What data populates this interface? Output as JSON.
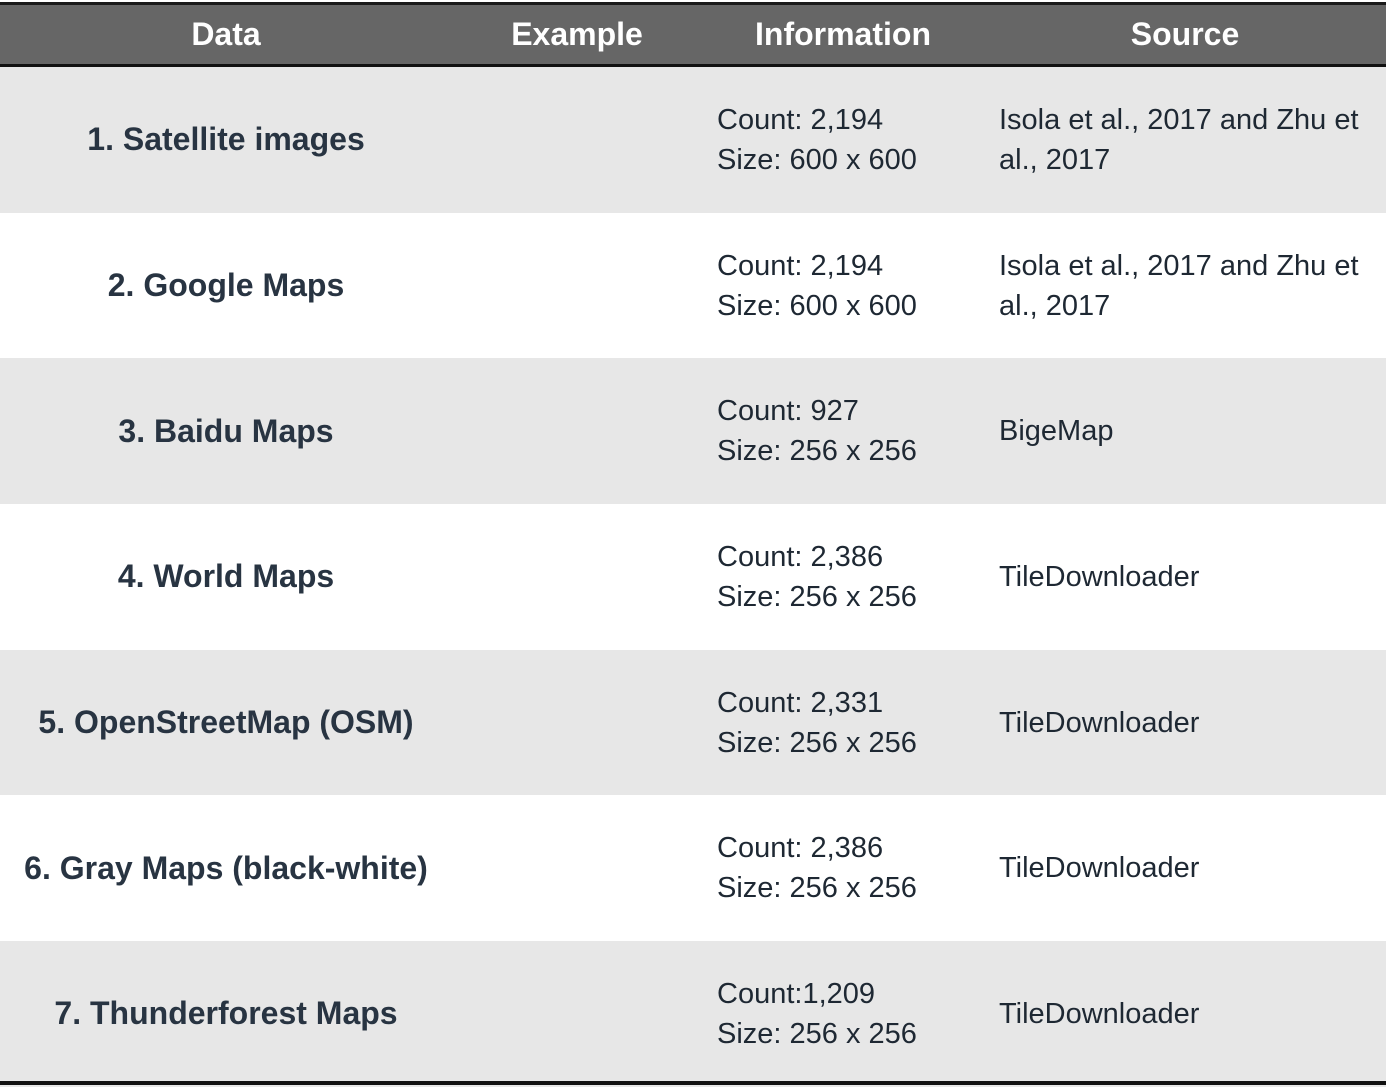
{
  "table": {
    "headers": {
      "data": "Data",
      "example": "Example",
      "information": "Information",
      "source": "Source"
    },
    "rows": [
      {
        "name": "1. Satellite images",
        "count": "Count: 2,194",
        "size": "Size: 600 x 600",
        "source": "Isola et al., 2017 and Zhu et al., 2017"
      },
      {
        "name": "2. Google Maps",
        "count": "Count: 2,194",
        "size": "Size: 600 x 600",
        "source": "Isola et al., 2017 and Zhu et al., 2017"
      },
      {
        "name": "3. Baidu Maps",
        "count": "Count: 927",
        "size": "Size: 256 x 256",
        "source": "BigeMap"
      },
      {
        "name": "4. World Maps",
        "count": "Count: 2,386",
        "size": "Size: 256 x 256",
        "source": "TileDownloader"
      },
      {
        "name": "5. OpenStreetMap (OSM)",
        "count": "Count: 2,331",
        "size": "Size: 256 x 256",
        "source": "TileDownloader"
      },
      {
        "name": "6. Gray Maps (black-white)",
        "count": "Count: 2,386",
        "size": "Size: 256 x 256",
        "source": "TileDownloader"
      },
      {
        "name": "7. Thunderforest Maps",
        "count": "Count:1,209",
        "size": "Size: 256 x 256",
        "source": "TileDownloader"
      }
    ]
  },
  "colors": {
    "header_bg": "#666666",
    "header_text": "#ffffff",
    "row_shade": "#e7e7e7",
    "row_plain": "#ffffff",
    "rule": "#111111"
  }
}
